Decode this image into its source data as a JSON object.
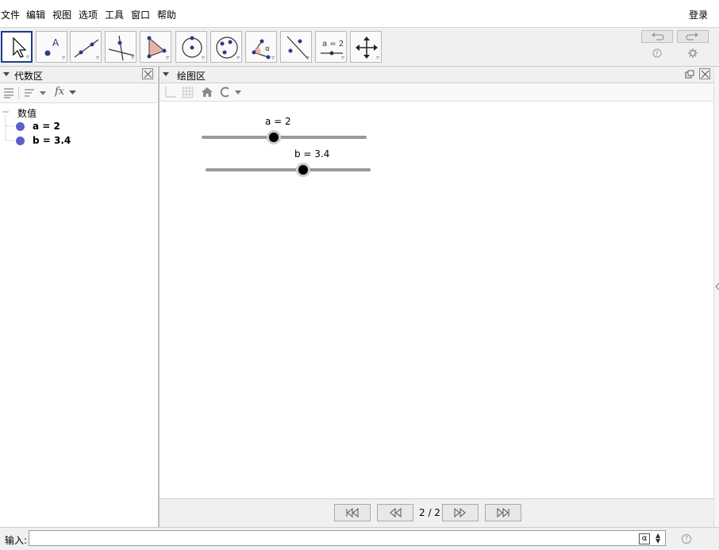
{
  "menu": {
    "items": [
      "文件",
      "编辑",
      "视图",
      "选项",
      "工具",
      "窗口",
      "帮助"
    ],
    "login": "登录"
  },
  "toolbar": {
    "tools": [
      "move-tool",
      "point-tool",
      "line-tool",
      "perpendicular-line-tool",
      "polygon-tool",
      "circle-tool",
      "circle-through-points-tool",
      "angle-tool",
      "reflect-tool",
      "slider-tool",
      "move-graphics-view-tool"
    ],
    "slider_icon_text": "a = 2"
  },
  "algebra": {
    "title": "代数区",
    "root": "数值",
    "items": [
      {
        "label": "a = 2",
        "color": "#5b60c8"
      },
      {
        "label": "b = 3.4",
        "color": "#5b60c8"
      }
    ],
    "fx_label": "fx"
  },
  "graphics": {
    "title": "绘图区",
    "sliders": [
      {
        "label": "a = 2",
        "value": 2
      },
      {
        "label": "b = 3.4",
        "value": 3.4
      }
    ]
  },
  "navigation": {
    "page": "2 / 2"
  },
  "inputbar": {
    "label": "输入:",
    "value": "",
    "alpha": "α"
  }
}
